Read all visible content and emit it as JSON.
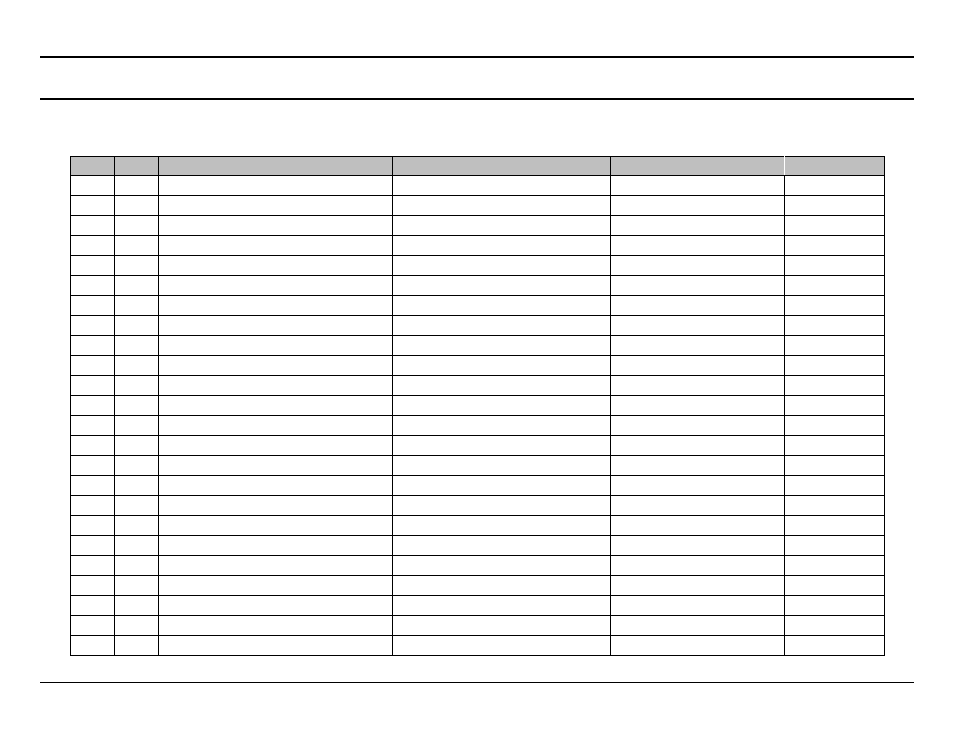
{
  "table": {
    "headers": [
      "",
      "",
      "",
      "",
      "",
      ""
    ],
    "rows": [
      [
        "",
        "",
        "",
        "",
        "",
        ""
      ],
      [
        "",
        "",
        "",
        "",
        "",
        ""
      ],
      [
        "",
        "",
        "",
        "",
        "",
        ""
      ],
      [
        "",
        "",
        "",
        "",
        "",
        ""
      ],
      [
        "",
        "",
        "",
        "",
        "",
        ""
      ],
      [
        "",
        "",
        "",
        "",
        "",
        ""
      ],
      [
        "",
        "",
        "",
        "",
        "",
        ""
      ],
      [
        "",
        "",
        "",
        "",
        "",
        ""
      ],
      [
        "",
        "",
        "",
        "",
        "",
        ""
      ],
      [
        "",
        "",
        "",
        "",
        "",
        ""
      ],
      [
        "",
        "",
        "",
        "",
        "",
        ""
      ],
      [
        "",
        "",
        "",
        "",
        "",
        ""
      ],
      [
        "",
        "",
        "",
        "",
        "",
        ""
      ],
      [
        "",
        "",
        "",
        "",
        "",
        ""
      ],
      [
        "",
        "",
        "",
        "",
        "",
        ""
      ],
      [
        "",
        "",
        "",
        "",
        "",
        ""
      ],
      [
        "",
        "",
        "",
        "",
        "",
        ""
      ],
      [
        "",
        "",
        "",
        "",
        "",
        ""
      ],
      [
        "",
        "",
        "",
        "",
        "",
        ""
      ],
      [
        "",
        "",
        "",
        "",
        "",
        ""
      ],
      [
        "",
        "",
        "",
        "",
        "",
        ""
      ],
      [
        "",
        "",
        "",
        "",
        "",
        ""
      ],
      [
        "",
        "",
        "",
        "",
        "",
        ""
      ],
      [
        "",
        "",
        "",
        "",
        "",
        ""
      ]
    ]
  }
}
